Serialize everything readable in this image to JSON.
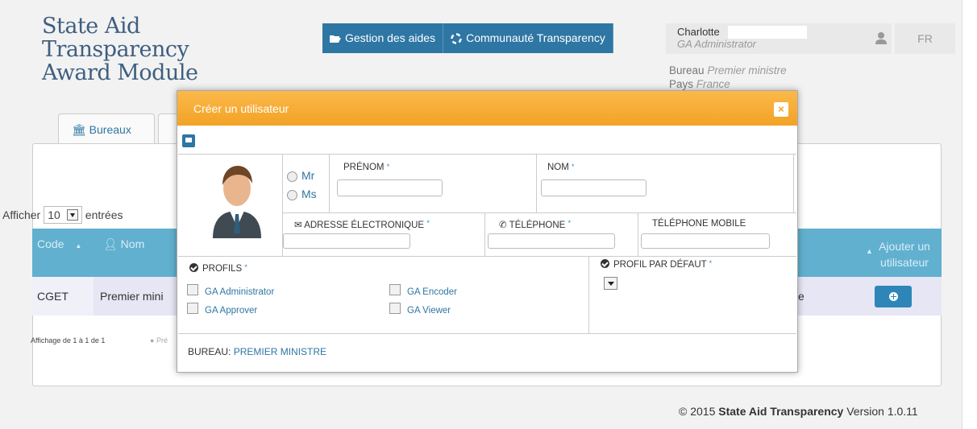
{
  "brand": {
    "line1": "State Aid",
    "line2": "Transparency",
    "line3": "Award Module"
  },
  "topnav": [
    {
      "label": "Gestion des aides",
      "icon": "folder-open-icon"
    },
    {
      "label": "Communauté Transparency",
      "icon": "life-ring-icon"
    }
  ],
  "user": {
    "name": "Charlotte",
    "role": "GA Administrator",
    "icon": "user-icon"
  },
  "lang": "FR",
  "office": {
    "bureau_label": "Bureau",
    "bureau_value": "Premier ministre",
    "pays_label": "Pays",
    "pays_value": "France"
  },
  "tabs": [
    {
      "label": "Bureaux",
      "icon": "bank-icon"
    }
  ],
  "table": {
    "show_label": "Afficher",
    "show_value": "10",
    "entries_label": "entrées",
    "columns": {
      "code": "Code",
      "nom": "Nom",
      "add": "Ajouter un utilisateur"
    },
    "rows": [
      {
        "code": "CGET",
        "nom": "Premier mini",
        "tail": "e"
      }
    ],
    "info": "Affichage de 1 à 1 de 1",
    "prev": "Pré"
  },
  "footer": {
    "prefix": "© 2015",
    "name": "State Aid Transparency",
    "version": "Version 1.0.11"
  },
  "modal": {
    "title": "Créer un utilisateur",
    "close": "×",
    "civility": [
      "Mr",
      "Ms"
    ],
    "fields": {
      "prenom": "PRÉNOM",
      "nom": "NOM",
      "email": "ADRESSE ÉLECTRONIQUE",
      "phone": "TÉLÉPHONE",
      "mobile": "TÉLÉPHONE MOBILE"
    },
    "required_mark": "*",
    "profiles_label": "PROFILS",
    "profiles": [
      "GA Administrator",
      "GA Encoder",
      "GA Approver",
      "GA Viewer"
    ],
    "default_profile_label": "PROFIL PAR DÉFAUT",
    "bureau_label": "BUREAU:",
    "bureau_value": "PREMIER MINISTRE"
  }
}
